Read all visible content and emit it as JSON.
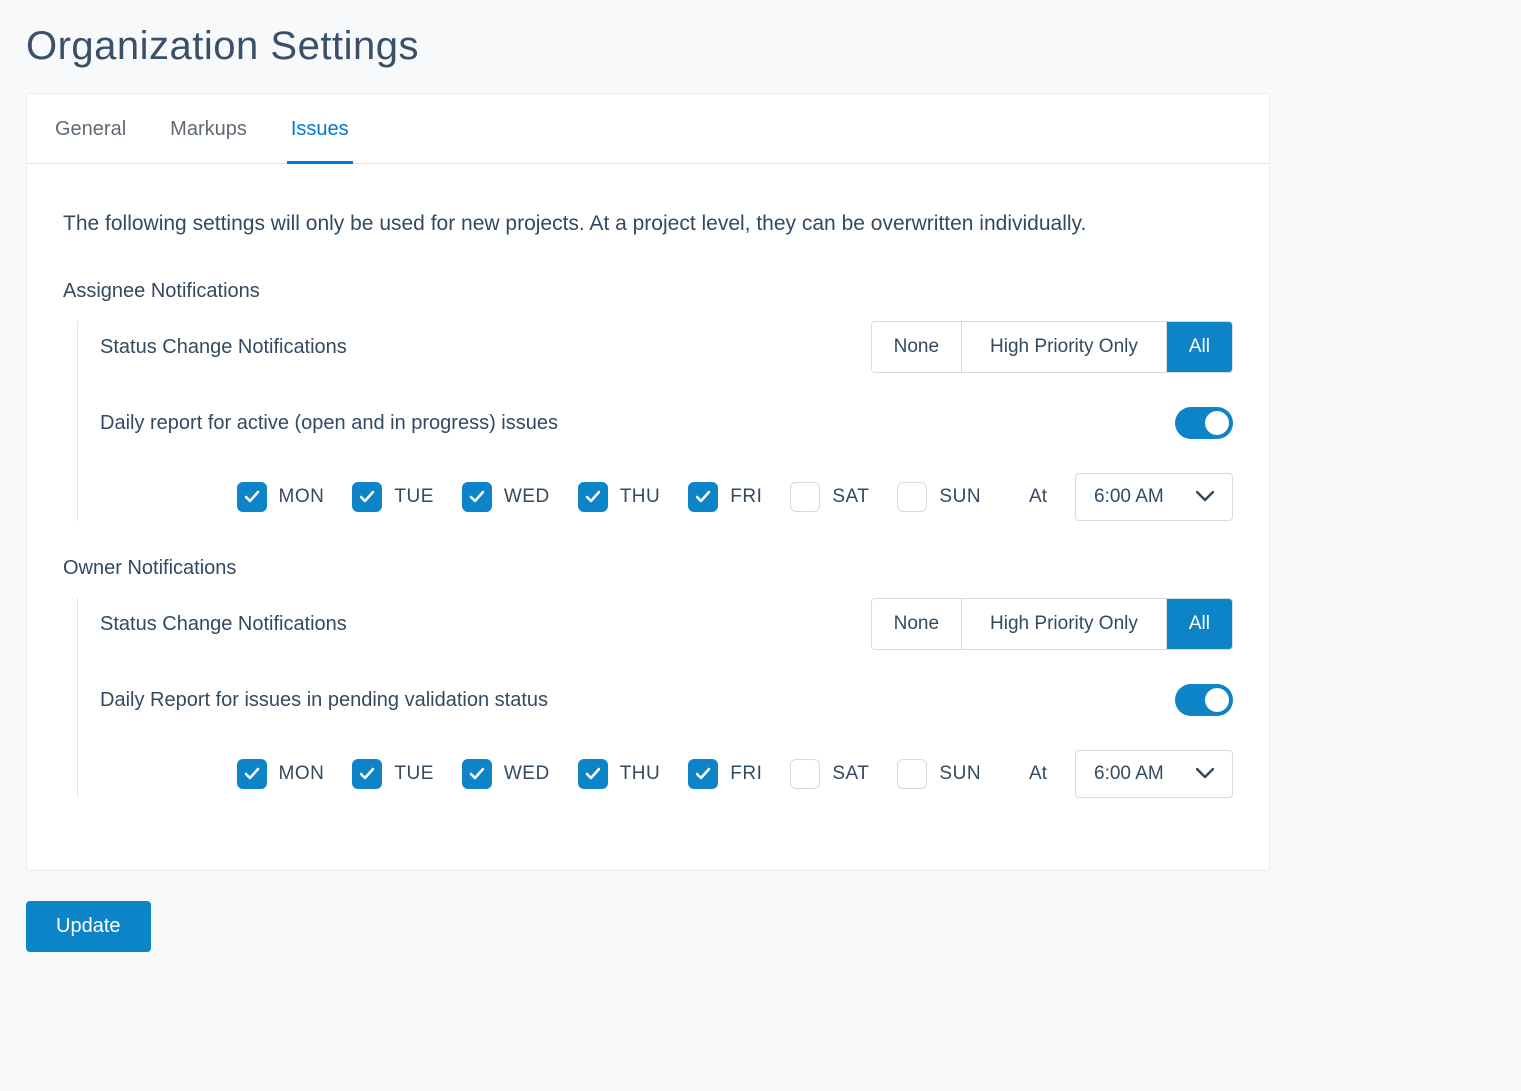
{
  "page_title": "Organization Settings",
  "tabs": {
    "general": "General",
    "markups": "Markups",
    "issues": "Issues",
    "active": "issues"
  },
  "intro": "The following settings will only be used for new projects. At a project level, they can be overwritten individually.",
  "buttons": {
    "update": "Update"
  },
  "seg_options": {
    "none": "None",
    "high": "High Priority Only",
    "all": "All"
  },
  "days": {
    "mon": "MON",
    "tue": "TUE",
    "wed": "WED",
    "thu": "THU",
    "fri": "FRI",
    "sat": "SAT",
    "sun": "SUN"
  },
  "at_label": "At",
  "assignee": {
    "title": "Assignee Notifications",
    "status_label": "Status Change Notifications",
    "status_selected": "all",
    "daily_label": "Daily report for active (open and in progress) issues",
    "daily_enabled": true,
    "days_checked": {
      "mon": true,
      "tue": true,
      "wed": true,
      "thu": true,
      "fri": true,
      "sat": false,
      "sun": false
    },
    "time": "6:00 AM"
  },
  "owner": {
    "title": "Owner Notifications",
    "status_label": "Status Change Notifications",
    "status_selected": "all",
    "daily_label": "Daily Report for issues in pending validation status",
    "daily_enabled": true,
    "days_checked": {
      "mon": true,
      "tue": true,
      "wed": true,
      "thu": true,
      "fri": true,
      "sat": false,
      "sun": false
    },
    "time": "6:00 AM"
  }
}
